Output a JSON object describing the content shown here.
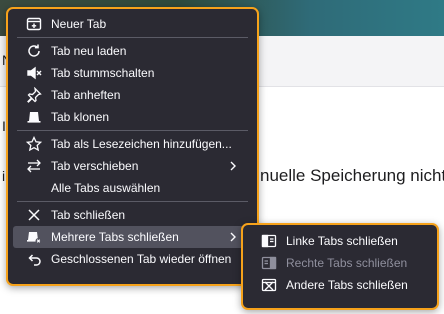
{
  "background": {
    "visible_text": "nuelle Speicherung nicht",
    "fragments": [
      "N",
      "I",
      "i"
    ]
  },
  "context_menu": {
    "items": [
      {
        "label": "Neuer Tab"
      },
      {
        "label": "Tab neu laden"
      },
      {
        "label": "Tab stummschalten"
      },
      {
        "label": "Tab anheften"
      },
      {
        "label": "Tab klonen"
      },
      {
        "label": "Tab als Lesezeichen hinzufügen..."
      },
      {
        "label": "Tab verschieben"
      },
      {
        "label": "Alle Tabs auswählen"
      },
      {
        "label": "Tab schließen"
      },
      {
        "label": "Mehrere Tabs schließen"
      },
      {
        "label": "Geschlossenen Tab wieder öffnen"
      }
    ]
  },
  "submenu": {
    "items": [
      {
        "label": "Linke Tabs schließen",
        "disabled": false
      },
      {
        "label": "Rechte Tabs schließen",
        "disabled": true
      },
      {
        "label": "Andere Tabs schließen",
        "disabled": false
      }
    ]
  },
  "colors": {
    "menu_bg": "#2b2a33",
    "highlight_border": "#f6a21b",
    "hover_bg": "#52525e",
    "disabled_text": "#8f8f9d"
  }
}
